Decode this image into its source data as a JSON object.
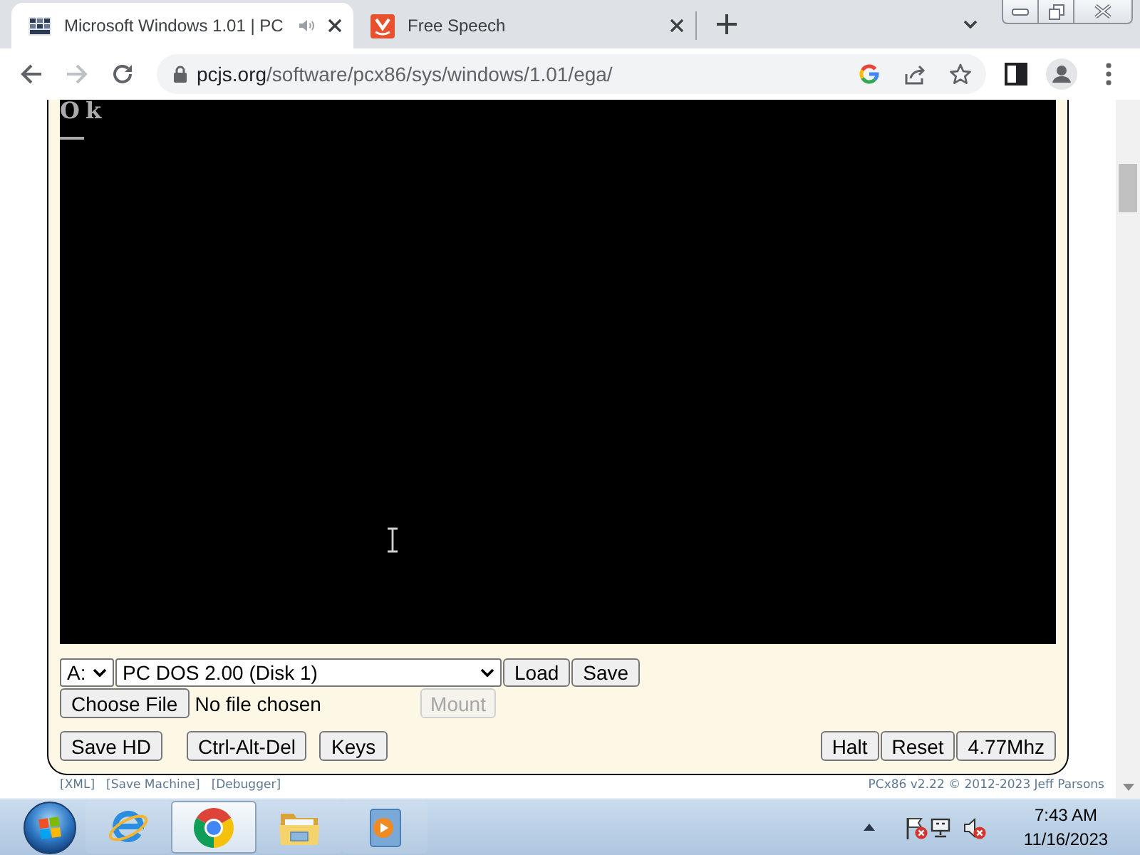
{
  "browser": {
    "tabs": [
      {
        "title": "Microsoft Windows 1.01 | PC",
        "selected": true,
        "audio_playing": true
      },
      {
        "title": "Free Speech",
        "selected": false,
        "audio_playing": false
      }
    ],
    "address": {
      "host": "pcjs.org",
      "path": "/software/pcx86/sys/windows/1.01/ega/"
    }
  },
  "machine": {
    "screen_lines": [
      "Ok"
    ],
    "drive": "A:",
    "disk": "PC DOS 2.00 (Disk 1)",
    "disk_buttons": [
      {
        "label": "Load",
        "disabled": false
      },
      {
        "label": "Save",
        "disabled": false
      }
    ],
    "file_button": "Choose File",
    "file_status": "No file chosen",
    "mount_button": {
      "label": "Mount",
      "disabled": true
    },
    "left_buttons": [
      {
        "label": "Save HD",
        "disabled": false
      },
      {
        "label": "Ctrl-Alt-Del",
        "disabled": false
      },
      {
        "label": "Keys",
        "disabled": false
      }
    ],
    "right_buttons": [
      {
        "label": "Halt",
        "disabled": false
      },
      {
        "label": "Reset",
        "disabled": false
      },
      {
        "label": "4.77Mhz",
        "disabled": false
      }
    ]
  },
  "footer": {
    "links": [
      "[XML]",
      "[Save Machine]",
      "[Debugger]"
    ],
    "credit": "PCx86 v2.22 © 2012-2023 Jeff Parsons"
  },
  "taskbar": {
    "apps": [
      {
        "kind": "e-globe",
        "selected": false
      },
      {
        "kind": "ring",
        "selected": true
      },
      {
        "kind": "folder",
        "selected": false
      },
      {
        "kind": "player",
        "selected": false
      }
    ],
    "tray": {
      "action_center_alert": true,
      "volume_muted": true
    },
    "time": "7:43 AM",
    "date": "11/16/2023"
  }
}
